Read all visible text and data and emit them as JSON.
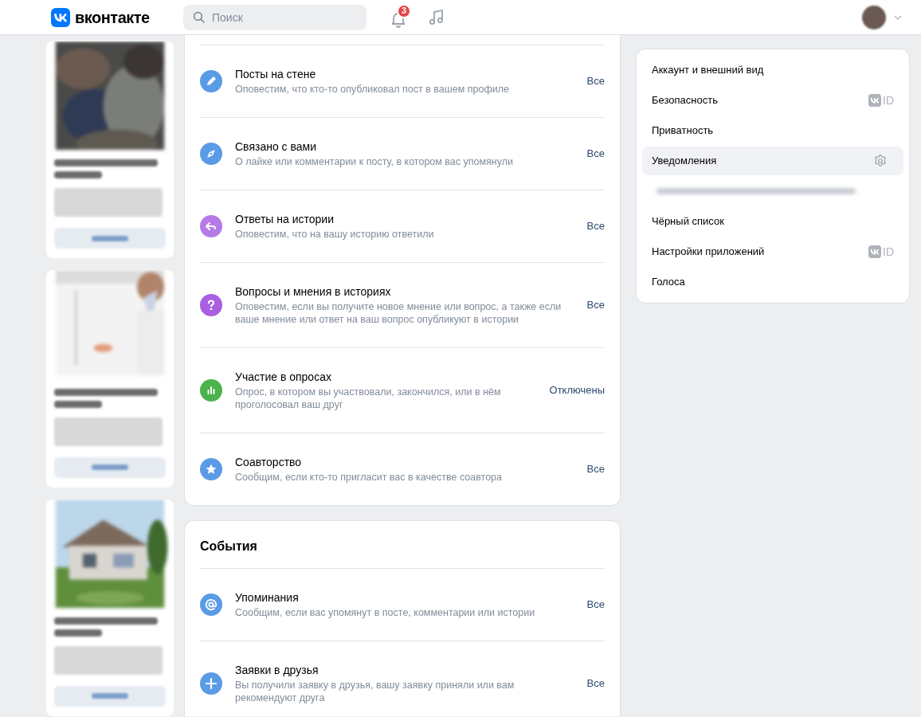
{
  "header": {
    "logo_text": "вконтакте",
    "search": {
      "placeholder": "Поиск"
    },
    "notifications_badge": "3"
  },
  "sections": [
    {
      "rows": [
        {
          "kind": "pencil",
          "color": "#5a9be6",
          "title": "Посты на стене",
          "description": "Оповестим, что кто-то опубликовал пост в вашем профиле",
          "value": "Все"
        },
        {
          "kind": "compass",
          "color": "#5a9be6",
          "title": "Связано с вами",
          "description": "О лайке или комментарии к посту, в котором вас упомянули",
          "value": "Все"
        },
        {
          "kind": "reply",
          "color": "#b57ae8",
          "title": "Ответы на истории",
          "description": "Оповестим, что на вашу историю ответили",
          "value": "Все"
        },
        {
          "kind": "question",
          "color": "#a95fe0",
          "title": "Вопросы и мнения в историях",
          "description": "Оповестим, если вы получите новое мнение или вопрос, а также если ваше мнение или ответ на ваш вопрос опубликуют в истории",
          "value": "Все"
        },
        {
          "kind": "poll",
          "color": "#4bb34b",
          "title": "Участие в опросах",
          "description": "Опрос, в котором вы участвовали, закончился, или в нём проголосовал ваш друг",
          "value": "Отключены"
        },
        {
          "kind": "star",
          "color": "#5a9be6",
          "title": "Соавторство",
          "description": "Сообщим, если кто-то пригласит вас в качестве соавтора",
          "value": "Все"
        }
      ]
    },
    {
      "title": "События",
      "rows": [
        {
          "kind": "at",
          "color": "#5a9be6",
          "title": "Упоминания",
          "description": "Сообщим, если вас упомянут в посте, комментарии или истории",
          "value": "Все"
        },
        {
          "kind": "plus",
          "color": "#5a9be6",
          "title": "Заявки в друзья",
          "description": "Вы получили заявку в друзья, вашу заявку приняли или вам рекомендуют друга",
          "value": "Все"
        }
      ]
    }
  ],
  "settings_menu": {
    "items": [
      {
        "kind": "item",
        "label": "Аккаунт и внешний вид",
        "selected": false
      },
      {
        "kind": "item",
        "label": "Безопасность",
        "selected": false,
        "badge": "ID"
      },
      {
        "kind": "item",
        "label": "Приватность",
        "selected": false
      },
      {
        "kind": "item",
        "label": "Уведомления",
        "selected": true
      },
      {
        "kind": "blurred"
      },
      {
        "kind": "item",
        "label": "Чёрный список",
        "selected": false
      },
      {
        "kind": "item",
        "label": "Настройки приложений",
        "selected": false,
        "badge": "ID"
      },
      {
        "kind": "item",
        "label": "Голоса",
        "selected": false
      }
    ]
  }
}
